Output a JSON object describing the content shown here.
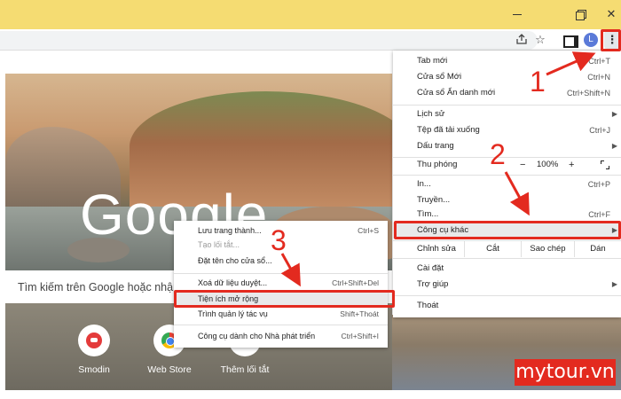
{
  "window": {
    "minimize": "—",
    "close": "✕"
  },
  "toolbar": {
    "avatar_letter": "L",
    "share_icon": "share-icon",
    "star": "☆",
    "menu_icon": "⋮"
  },
  "new_tab": {
    "logo": "Google",
    "search_placeholder": "Tìm kiếm trên Google hoặc nhập",
    "shortcuts": [
      {
        "label": "Smodin"
      },
      {
        "label": "Web Store"
      },
      {
        "label": "Thêm lối tắt",
        "icon": "+"
      }
    ]
  },
  "menu": {
    "new_tab": {
      "label": "Tab mới",
      "key": "Ctrl+T"
    },
    "new_window": {
      "label": "Cửa sổ Mới",
      "key": "Ctrl+N"
    },
    "incognito": {
      "label": "Cửa sổ Ẩn danh mới",
      "key": "Ctrl+Shift+N"
    },
    "history": {
      "label": "Lịch sử",
      "arrow": "▶"
    },
    "downloads": {
      "label": "Tệp đã tải xuống",
      "key": "Ctrl+J"
    },
    "bookmarks": {
      "label": "Dấu trang",
      "arrow": "▶"
    },
    "zoom": {
      "label": "Thu phóng",
      "minus": "−",
      "value": "100%",
      "plus": "+"
    },
    "print": {
      "label": "In...",
      "key": "Ctrl+P"
    },
    "cast": {
      "label": "Truyền..."
    },
    "find": {
      "label": "Tìm...",
      "key": "Ctrl+F"
    },
    "more_tools": {
      "label": "Công cụ khác",
      "arrow": "▶"
    },
    "edit": {
      "label": "Chỉnh sửa",
      "cut": "Cắt",
      "copy": "Sao chép",
      "paste": "Dán"
    },
    "settings": {
      "label": "Cài đặt"
    },
    "help": {
      "label": "Trợ giúp",
      "arrow": "▶"
    },
    "exit": {
      "label": "Thoát"
    }
  },
  "submenu": {
    "save_page": {
      "label": "Lưu trang thành...",
      "key": "Ctrl+S"
    },
    "create_shortcut": {
      "label": "Tạo lối tắt..."
    },
    "name_window": {
      "label": "Đặt tên cho cửa sổ..."
    },
    "clear_data": {
      "label": "Xoá dữ liệu duyệt...",
      "key": "Ctrl+Shift+Del"
    },
    "extensions": {
      "label": "Tiện ích mở rộng"
    },
    "task_manager": {
      "label": "Trình quản lý tác vụ",
      "key": "Shift+Thoát"
    },
    "dev_tools": {
      "label": "Công cụ dành cho Nhà phát triển",
      "key": "Ctrl+Shift+I"
    }
  },
  "annotations": {
    "step1": "1",
    "step2": "2",
    "step3": "3",
    "color": "#e32a1f"
  },
  "watermark": "mytour.vn"
}
